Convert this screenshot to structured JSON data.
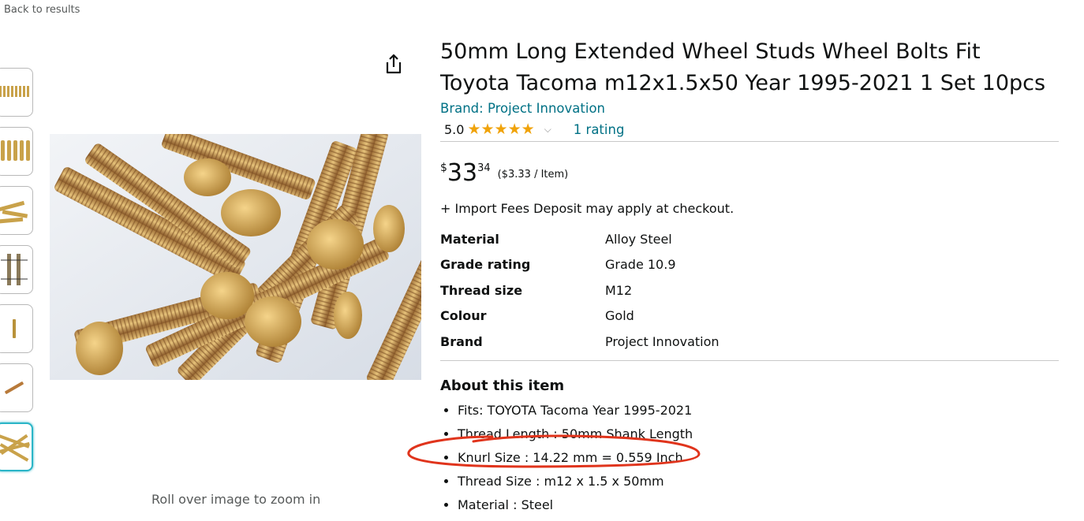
{
  "nav": {
    "back": "Back to results"
  },
  "gallery": {
    "thumb_count": 7,
    "selected_index": 6,
    "zoom_hint": "Roll over image to zoom in"
  },
  "product": {
    "title_line1": "50mm Long Extended Wheel Studs Wheel Bolts Fit",
    "title_line2": "Toyota Tacoma m12x1.5x50 Year 1995-2021 1 Set 10pcs",
    "brand": "Brand: Project Innovation",
    "rating_value": "5.0",
    "rating_stars": 5,
    "rating_count": "1 rating",
    "price_symbol": "$",
    "price_whole": "33",
    "price_fraction": "34",
    "unit_price": "($3.33 / Item)",
    "import_fees": "+ Import Fees Deposit may apply at checkout."
  },
  "specs": [
    {
      "key": "Material",
      "value": "Alloy Steel"
    },
    {
      "key": "Grade rating",
      "value": "Grade 10.9"
    },
    {
      "key": "Thread size",
      "value": "M12"
    },
    {
      "key": "Colour",
      "value": "Gold"
    },
    {
      "key": "Brand",
      "value": "Project Innovation"
    }
  ],
  "about": {
    "title": "About this item",
    "bullets": [
      "Fits: TOYOTA Tacoma Year 1995-2021",
      "Thread Length : 50mm Shank Length",
      "Knurl Size : 14.22 mm = 0.559 Inch",
      "Thread Size : m12 x 1.5 x 50mm",
      "Material : Steel"
    ]
  },
  "icons": {
    "share": "share-icon",
    "star": "star-icon",
    "chevron": "chevron-down-icon"
  },
  "colors": {
    "link": "#007185",
    "star": "#f0a30a",
    "annotation": "#e0341c",
    "thumb_selected": "#2bb5c7"
  }
}
